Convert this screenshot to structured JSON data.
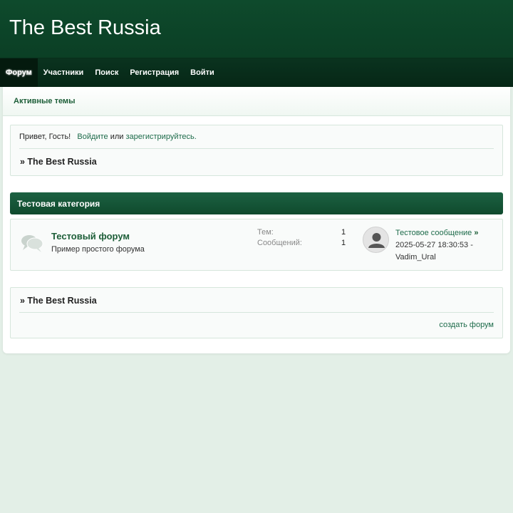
{
  "header": {
    "site_title": "The Best Russia"
  },
  "nav": {
    "items": [
      {
        "label": "Форум"
      },
      {
        "label": "Участники"
      },
      {
        "label": "Поиск"
      },
      {
        "label": "Регистрация"
      },
      {
        "label": "Войти"
      }
    ]
  },
  "subnav": {
    "active_topics": "Активные темы"
  },
  "welcome": {
    "greeting": "Привет, Гость!",
    "login_link": "Войдите",
    "or_text": "или",
    "register_link": "зарегистрируйтесь.",
    "breadcrumb": "» The Best Russia"
  },
  "category": {
    "title": "Тестовая категория",
    "forums": [
      {
        "title": "Тестовый форум",
        "description": "Пример простого форума",
        "topics_label": "Тем:",
        "topics_count": "1",
        "posts_label": "Сообщений:",
        "posts_count": "1",
        "last_post_title": "Тестовое сообщение",
        "last_post_raquo": "»",
        "last_post_date": "2025-05-27 18:30:53 -",
        "last_post_author": "Vadim_Ural"
      }
    ]
  },
  "footer": {
    "breadcrumb": "» The Best Russia",
    "create_forum": "создать форум"
  },
  "colors": {
    "header_bg": "#0e4a2c",
    "nav_bg": "#0a331f",
    "page_bg": "#e3efe7",
    "link": "#1d6b4a"
  }
}
